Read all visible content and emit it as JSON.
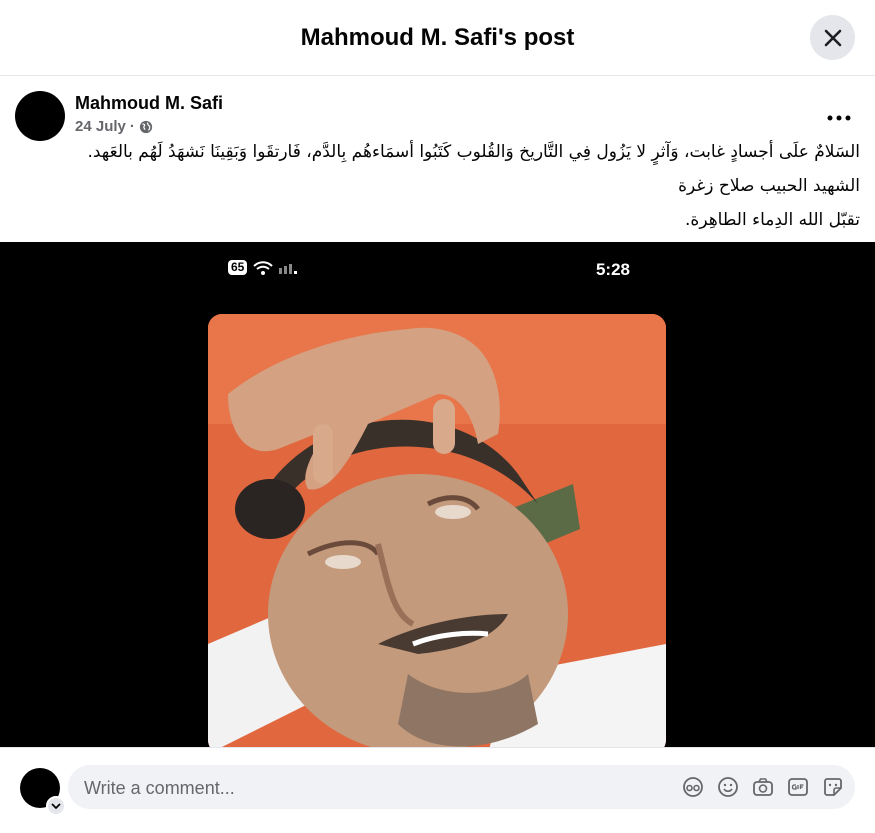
{
  "header": {
    "title": "Mahmoud M. Safi's post"
  },
  "post": {
    "author": "Mahmoud M. Safi",
    "date": "24 July",
    "separator": "·",
    "privacy_icon": "globe-icon",
    "caption_lines": [
      "السَلامٌ علَى أجسادٍ غابت، وَآثرٍ لا يَزُول فِي التَّاريخ وَالقُلوب كَتَبُوا أسمَاءهُم بِالدَّم، فَارتقَوا وَبَقِينَا نَشهَدُ لَهُم بالعَهد.",
      "الشهيد الحبيب صلاح زغرة",
      "تقبّل الله الدِماء الطاهِرة."
    ]
  },
  "media": {
    "status_bar": {
      "battery": "65",
      "time": "5:28"
    }
  },
  "composer": {
    "placeholder": "Write a comment...",
    "tools": [
      "avatar-sticker-icon",
      "emoji-icon",
      "camera-icon",
      "gif-icon",
      "sticker-icon"
    ]
  }
}
